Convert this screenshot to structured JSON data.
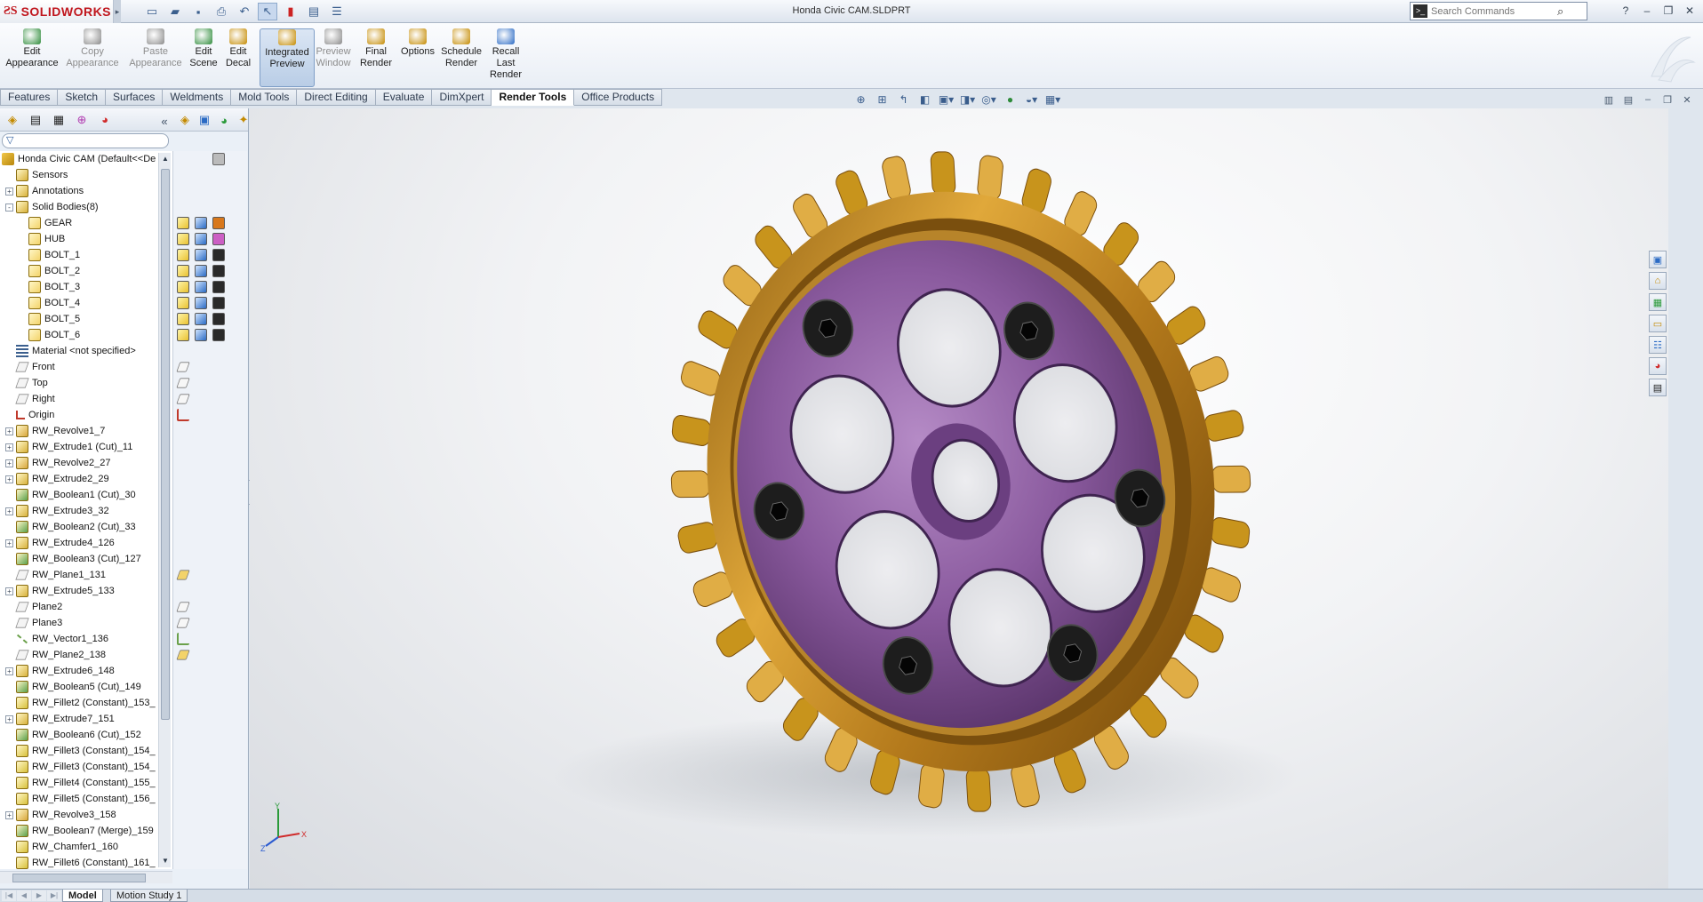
{
  "app": {
    "name": "SOLIDWORKS",
    "document_title": "Honda Civic CAM.SLDPRT",
    "search_placeholder": "Search Commands"
  },
  "command_manager": {
    "buttons": [
      {
        "label": "Edit\nAppearance",
        "icon": "edit-appearance-icon",
        "enabled": true
      },
      {
        "label": "Copy\nAppearance",
        "icon": "copy-appearance-icon",
        "enabled": false
      },
      {
        "label": "Paste\nAppearance",
        "icon": "paste-appearance-icon",
        "enabled": false
      },
      {
        "label": "Edit\nScene",
        "icon": "edit-scene-icon",
        "enabled": true
      },
      {
        "label": "Edit\nDecal",
        "icon": "edit-decal-icon",
        "enabled": true
      },
      {
        "label": "Integrated\nPreview",
        "icon": "integrated-preview-icon",
        "enabled": true,
        "active": true
      },
      {
        "label": "Preview\nWindow",
        "icon": "preview-window-icon",
        "enabled": false
      },
      {
        "label": "Final\nRender",
        "icon": "final-render-icon",
        "enabled": true
      },
      {
        "label": "Options",
        "icon": "options-icon",
        "enabled": true
      },
      {
        "label": "Schedule\nRender",
        "icon": "schedule-render-icon",
        "enabled": true
      },
      {
        "label": "Recall\nLast\nRender",
        "icon": "recall-last-render-icon",
        "enabled": true
      }
    ]
  },
  "tabs": [
    "Features",
    "Sketch",
    "Surfaces",
    "Weldments",
    "Mold Tools",
    "Direct Editing",
    "Evaluate",
    "DimXpert",
    "Render Tools",
    "Office Products"
  ],
  "active_tab": "Render Tools",
  "tree": {
    "root": "Honda Civic CAM  (Default<<De",
    "items": [
      {
        "label": "Sensors",
        "icon": "sensors-icon",
        "expander": false,
        "indent": false
      },
      {
        "label": "Annotations",
        "icon": "annotations-icon",
        "expander": "+",
        "indent": false
      },
      {
        "label": "Solid Bodies(8)",
        "icon": "solid-bodies-folder-icon",
        "expander": "-",
        "indent": false
      },
      {
        "label": "GEAR",
        "icon": "body-icon",
        "expander": false,
        "indent": true
      },
      {
        "label": "HUB",
        "icon": "body-icon",
        "expander": false,
        "indent": true
      },
      {
        "label": "BOLT_1",
        "icon": "body-icon",
        "expander": false,
        "indent": true
      },
      {
        "label": "BOLT_2",
        "icon": "body-icon",
        "expander": false,
        "indent": true
      },
      {
        "label": "BOLT_3",
        "icon": "body-icon",
        "expander": false,
        "indent": true
      },
      {
        "label": "BOLT_4",
        "icon": "body-icon",
        "expander": false,
        "indent": true
      },
      {
        "label": "BOLT_5",
        "icon": "body-icon",
        "expander": false,
        "indent": true
      },
      {
        "label": "BOLT_6",
        "icon": "body-icon",
        "expander": false,
        "indent": true
      },
      {
        "label": "Material <not specified>",
        "icon": "material-icon",
        "expander": false,
        "indent": false
      },
      {
        "label": "Front",
        "icon": "plane-icon",
        "expander": false,
        "indent": false
      },
      {
        "label": "Top",
        "icon": "plane-icon",
        "expander": false,
        "indent": false
      },
      {
        "label": "Right",
        "icon": "plane-icon",
        "expander": false,
        "indent": false
      },
      {
        "label": "Origin",
        "icon": "origin-icon",
        "expander": false,
        "indent": false
      },
      {
        "label": "RW_Revolve1_7",
        "icon": "revolve-icon",
        "expander": "+",
        "indent": false
      },
      {
        "label": "RW_Extrude1 (Cut)_11",
        "icon": "extrude-icon",
        "expander": "+",
        "indent": false
      },
      {
        "label": "RW_Revolve2_27",
        "icon": "revolve-icon",
        "expander": "+",
        "indent": false
      },
      {
        "label": "RW_Extrude2_29",
        "icon": "extrude-icon",
        "expander": "+",
        "indent": false
      },
      {
        "label": "RW_Boolean1 (Cut)_30",
        "icon": "boolean-icon",
        "expander": false,
        "indent": false
      },
      {
        "label": "RW_Extrude3_32",
        "icon": "extrude-icon",
        "expander": "+",
        "indent": false
      },
      {
        "label": "RW_Boolean2 (Cut)_33",
        "icon": "boolean-icon",
        "expander": false,
        "indent": false
      },
      {
        "label": "RW_Extrude4_126",
        "icon": "extrude-icon",
        "expander": "+",
        "indent": false
      },
      {
        "label": "RW_Boolean3 (Cut)_127",
        "icon": "boolean-icon",
        "expander": false,
        "indent": false
      },
      {
        "label": "RW_Plane1_131",
        "icon": "plane-icon",
        "expander": false,
        "indent": false
      },
      {
        "label": "RW_Extrude5_133",
        "icon": "extrude-icon",
        "expander": "+",
        "indent": false
      },
      {
        "label": "Plane2",
        "icon": "plane-icon",
        "expander": false,
        "indent": false
      },
      {
        "label": "Plane3",
        "icon": "plane-icon",
        "expander": false,
        "indent": false
      },
      {
        "label": "RW_Vector1_136",
        "icon": "axis-icon",
        "expander": false,
        "indent": false
      },
      {
        "label": "RW_Plane2_138",
        "icon": "plane-icon",
        "expander": false,
        "indent": false
      },
      {
        "label": "RW_Extrude6_148",
        "icon": "extrude-icon",
        "expander": "+",
        "indent": false
      },
      {
        "label": "RW_Boolean5 (Cut)_149",
        "icon": "boolean-icon",
        "expander": false,
        "indent": false
      },
      {
        "label": "RW_Fillet2 (Constant)_153_",
        "icon": "fillet-icon",
        "expander": false,
        "indent": false
      },
      {
        "label": "RW_Extrude7_151",
        "icon": "extrude-icon",
        "expander": "+",
        "indent": false
      },
      {
        "label": "RW_Boolean6 (Cut)_152",
        "icon": "boolean-icon",
        "expander": false,
        "indent": false
      },
      {
        "label": "RW_Fillet3 (Constant)_154_",
        "icon": "fillet-icon",
        "expander": false,
        "indent": false
      },
      {
        "label": "RW_Fillet3 (Constant)_154_",
        "icon": "fillet-icon",
        "expander": false,
        "indent": false
      },
      {
        "label": "RW_Fillet4 (Constant)_155_",
        "icon": "fillet-icon",
        "expander": false,
        "indent": false
      },
      {
        "label": "RW_Fillet5 (Constant)_156_",
        "icon": "fillet-icon",
        "expander": false,
        "indent": false
      },
      {
        "label": "RW_Revolve3_158",
        "icon": "revolve-icon",
        "expander": "+",
        "indent": false
      },
      {
        "label": "RW_Boolean7 (Merge)_159",
        "icon": "boolean-icon",
        "expander": false,
        "indent": false
      },
      {
        "label": "RW_Chamfer1_160",
        "icon": "chamfer-icon",
        "expander": false,
        "indent": false
      },
      {
        "label": "RW_Fillet6 (Constant)_161_",
        "icon": "fillet-icon",
        "expander": false,
        "indent": false
      }
    ]
  },
  "appearance_swatches": {
    "GEAR": "#d8781c",
    "HUB": "#cc5fc4",
    "BOLT": "#2a2a2a"
  },
  "bottom_tabs": [
    "Model",
    "Motion Study 1"
  ],
  "active_bottom_tab": "Model",
  "triad": {
    "x": "X",
    "y": "Y",
    "z": "Z"
  },
  "colors": {
    "gear": "#c8941c",
    "hub": "#8a5a9e",
    "bolts": "#1d1d1d",
    "brand": "#c0161d"
  }
}
